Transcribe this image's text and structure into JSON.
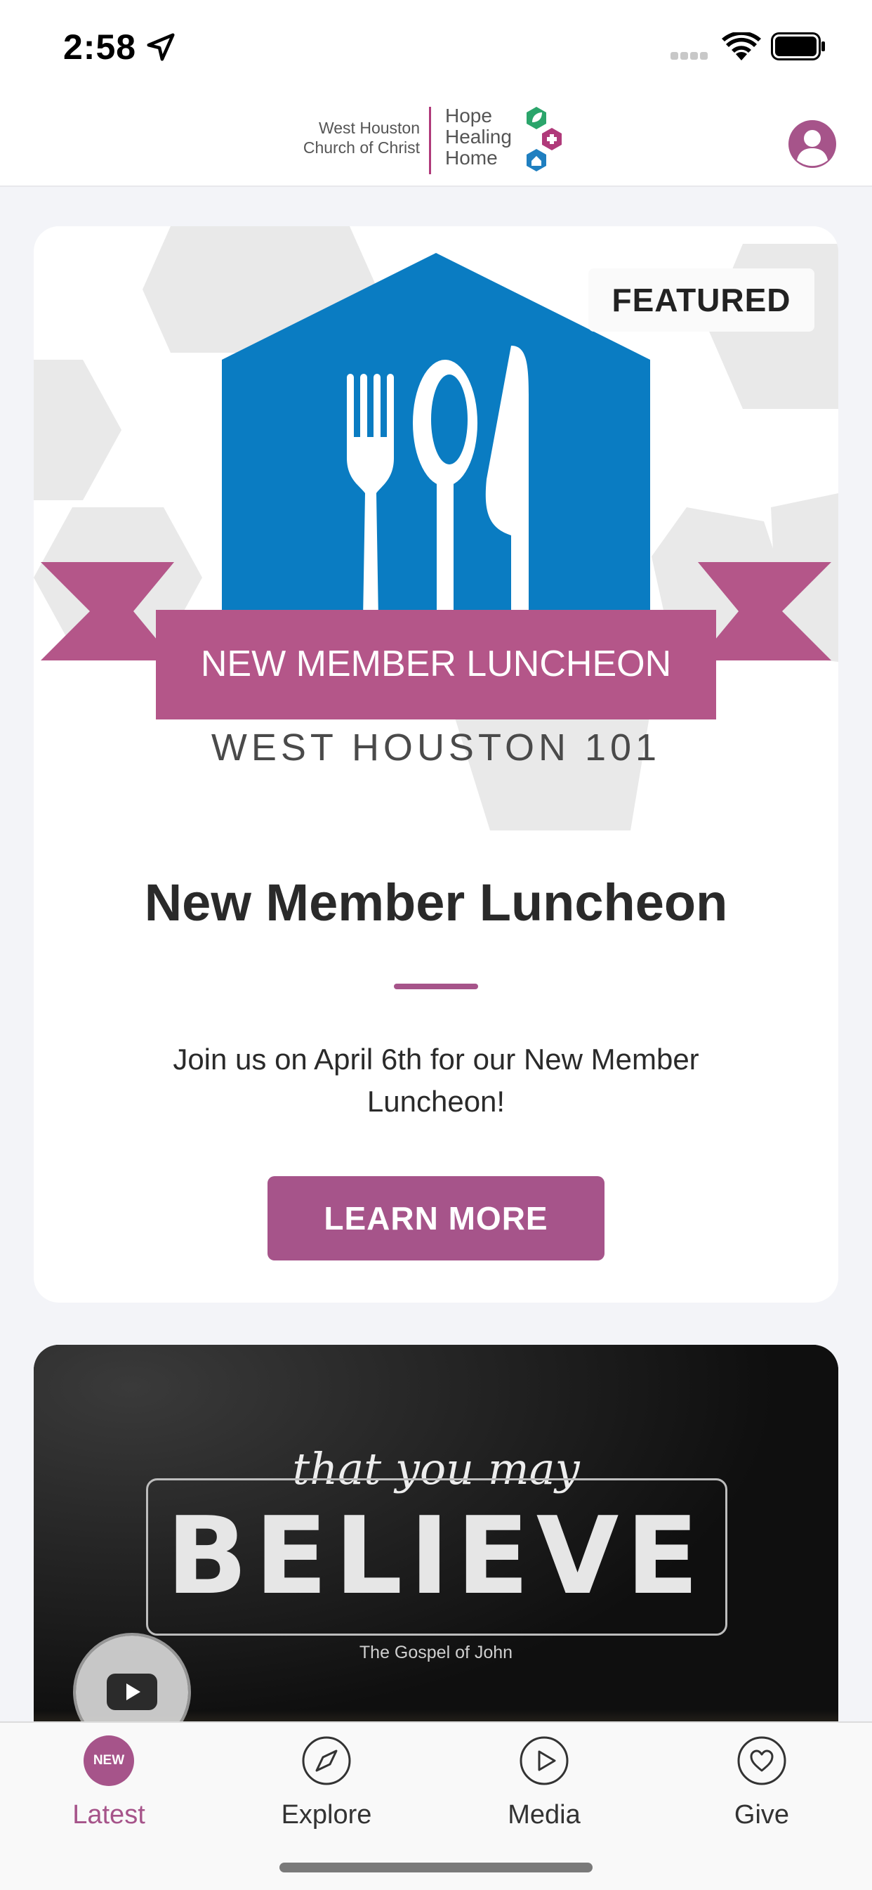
{
  "status": {
    "time": "2:58"
  },
  "header": {
    "church_line1": "West Houston",
    "church_line2": "Church of Christ",
    "tagline": [
      "Hope",
      "Healing",
      "Home"
    ]
  },
  "featured": {
    "badge": "FEATURED",
    "banner_text": "NEW MEMBER LUNCHEON",
    "banner_subtext": "WEST HOUSTON 101",
    "title": "New Member Luncheon",
    "description": "Join us on April 6th for our New Member Luncheon!",
    "button": "LEARN MORE"
  },
  "media": {
    "kicker": "that you may",
    "title": "BELIEVE",
    "subtitle": "The Gospel of John"
  },
  "tabs": [
    {
      "label": "Latest",
      "badge": "NEW",
      "active": true
    },
    {
      "label": "Explore",
      "icon": "compass-icon"
    },
    {
      "label": "Media",
      "icon": "play-icon"
    },
    {
      "label": "Give",
      "icon": "heart-icon"
    }
  ],
  "colors": {
    "accent": "#a6548a",
    "brand_blue": "#0a7cc2",
    "banner_pink": "#b45689"
  }
}
